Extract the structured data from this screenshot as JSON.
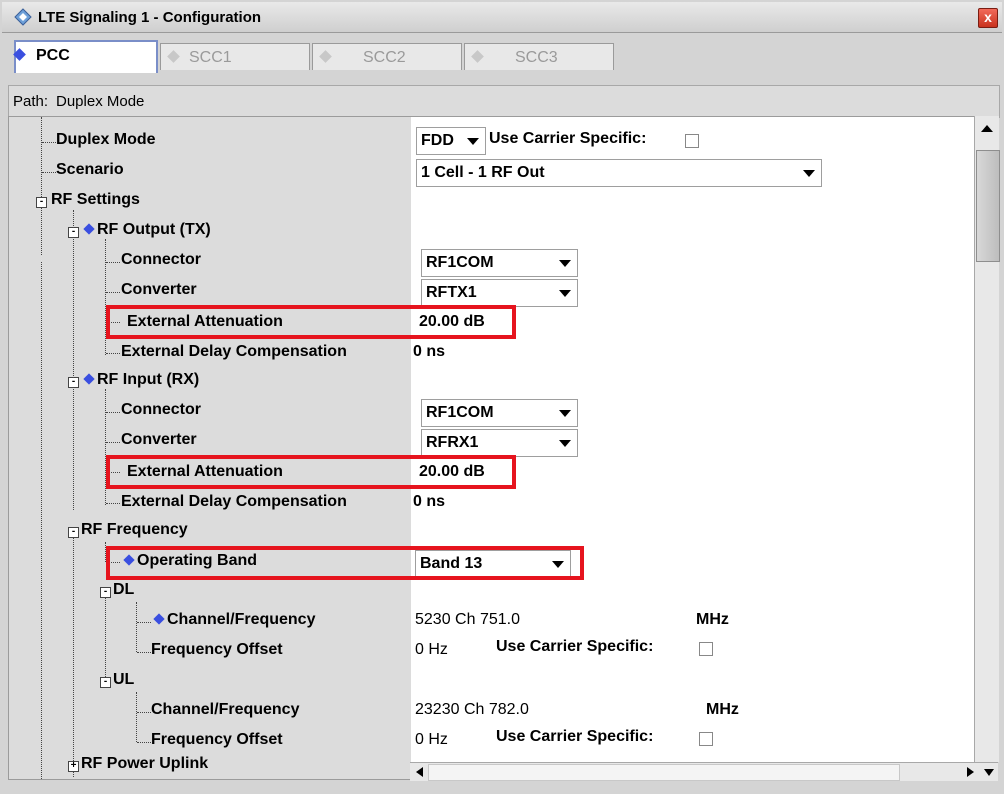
{
  "window": {
    "title": "LTE Signaling 1 - Configuration",
    "close_label": "x"
  },
  "tabs": [
    {
      "label": "PCC",
      "active": true
    },
    {
      "label": "SCC1",
      "active": false
    },
    {
      "label": "SCC2",
      "active": false
    },
    {
      "label": "SCC3",
      "active": false
    }
  ],
  "path": {
    "prefix": "Path:",
    "value": "Duplex Mode"
  },
  "tree": {
    "duplex_mode": {
      "label": "Duplex Mode",
      "value": "FDD",
      "carrier_label": "Use Carrier Specific:"
    },
    "scenario": {
      "label": "Scenario",
      "value": "1 Cell - 1 RF Out"
    },
    "rf_settings": {
      "label": "RF Settings"
    },
    "rf_output": {
      "label": "RF Output (TX)",
      "connector_label": "Connector",
      "connector_value": "RF1COM",
      "converter_label": "Converter",
      "converter_value": "RFTX1",
      "ext_att_label": "External Attenuation",
      "ext_att_value": "20.00 dB",
      "ext_delay_label": "External Delay Compensation",
      "ext_delay_value": "0 ns"
    },
    "rf_input": {
      "label": "RF Input (RX)",
      "connector_label": "Connector",
      "connector_value": "RF1COM",
      "converter_label": "Converter",
      "converter_value": "RFRX1",
      "ext_att_label": "External Attenuation",
      "ext_att_value": "20.00 dB",
      "ext_delay_label": "External Delay Compensation",
      "ext_delay_value": "0 ns"
    },
    "rf_frequency": {
      "label": "RF Frequency",
      "operating_band_label": "Operating Band",
      "operating_band_value": "Band 13",
      "dl": {
        "label": "DL",
        "channel_label": "Channel/Frequency",
        "channel_value": "5230 Ch 751.0",
        "channel_unit": "MHz",
        "offset_label": "Frequency Offset",
        "offset_value": "0 Hz",
        "carrier_label": "Use Carrier Specific:"
      },
      "ul": {
        "label": "UL",
        "channel_label": "Channel/Frequency",
        "channel_value": "23230 Ch 782.0",
        "channel_unit": "MHz",
        "offset_label": "Frequency Offset",
        "offset_value": "0 Hz",
        "carrier_label": "Use Carrier Specific:"
      }
    },
    "rf_power_uplink": {
      "label": "RF Power Uplink"
    }
  },
  "colors": {
    "highlight": "#e6141e",
    "diamond": "#3a4fe0",
    "tab_border": "#7a8ec8"
  },
  "icons": [
    "app-logo-icon",
    "close-icon",
    "expand-icon",
    "collapse-icon",
    "dropdown-arrow-icon",
    "diamond-icon"
  ]
}
